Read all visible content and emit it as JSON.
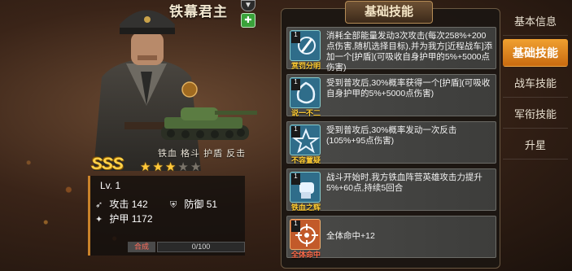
{
  "hero": {
    "title": "铁幕君主",
    "top_badge_icon": "v-badge-icon",
    "green_badge_icon": "plus-badge-icon",
    "tank_tags": "铁血 格斗 护盾 反击",
    "grade": "SSS",
    "stars_filled": 3,
    "stars_total": 5,
    "level": "Lv. 1",
    "stats": {
      "attack_label": "攻击",
      "attack_value": "142",
      "defense_label": "防御",
      "defense_value": "51",
      "armor_label": "护甲",
      "armor_value": "1172"
    },
    "merge_label": "合成",
    "merge_progress": "0/100"
  },
  "panel": {
    "title": "基础技能",
    "skills": [
      {
        "name": "赏罚分明",
        "level": "1",
        "icon": "sword-shield-icon",
        "desc": "消耗全部能量发动3次攻击(每次258%+200点伤害,随机选择目标),并为我方[近程战车]添加一个[护盾](可吸收自身护甲的5%+5000点伤害)"
      },
      {
        "name": "说一不二",
        "level": "1",
        "icon": "shield-swirl-icon",
        "desc": "受到普攻后,30%概率获得一个[护盾](可吸收自身护甲的5%+5000点伤害)"
      },
      {
        "name": "不容置疑",
        "level": "1",
        "icon": "counter-strike-icon",
        "desc": "受到普攻后,30%概率发动一次反击(105%+95点伤害)"
      },
      {
        "name": "铁血之辉",
        "level": "1",
        "icon": "fist-icon",
        "desc": "战斗开始时,我方铁血阵营英雄攻击力提升5%+60点,持续5回合"
      },
      {
        "name": "全体命中",
        "level": "1",
        "icon": "crosshair-icon",
        "desc": "全体命中+12"
      }
    ]
  },
  "tabs": [
    "基本信息",
    "基础技能",
    "战车技能",
    "军衔技能",
    "升星"
  ],
  "active_tab": "基础技能"
}
